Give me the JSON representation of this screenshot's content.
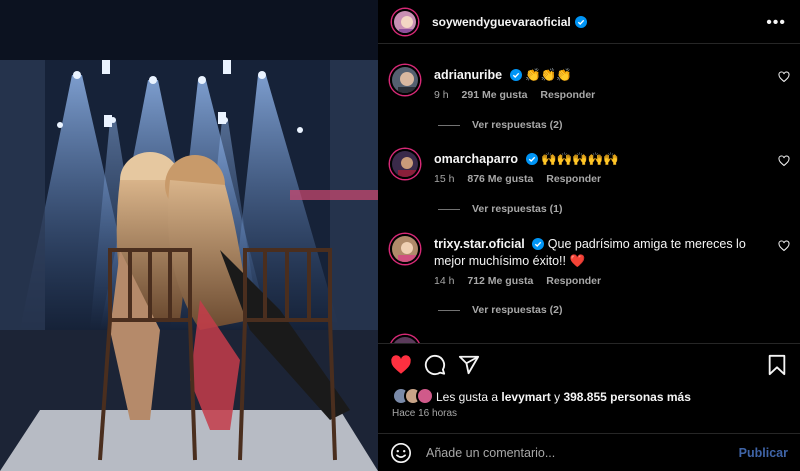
{
  "post": {
    "author": "soywendyguevaraoficial",
    "more_icon": "more-horizontal-icon"
  },
  "comments": [
    {
      "user": "adrianuribe",
      "text": "👏👏👏",
      "time": "9 h",
      "likes": "291 Me gusta",
      "reply": "Responder",
      "replies": "Ver respuestas (2)"
    },
    {
      "user": "omarchaparro",
      "text": "🙌🙌🙌🙌🙌",
      "time": "15 h",
      "likes": "876 Me gusta",
      "reply": "Responder",
      "replies": "Ver respuestas (1)"
    },
    {
      "user": "trixy.star.oficial",
      "text": "Que padrísimo amiga te mereces lo mejor muchísimo éxito!! ❤️",
      "time": "14 h",
      "likes": "712 Me gusta",
      "reply": "Responder",
      "replies": "Ver respuestas (2)"
    }
  ],
  "likes_summary": {
    "prefix": "Les gusta a",
    "user": "levymart",
    "connector": "y",
    "count": "398.855 personas más"
  },
  "posted": "Hace 16 horas",
  "add_comment": {
    "placeholder": "Añade un comentario...",
    "publish": "Publicar"
  },
  "colors": {
    "like_red": "#ff3040",
    "verified_blue": "#0095f6",
    "publish_blue": "#3f64a7"
  }
}
